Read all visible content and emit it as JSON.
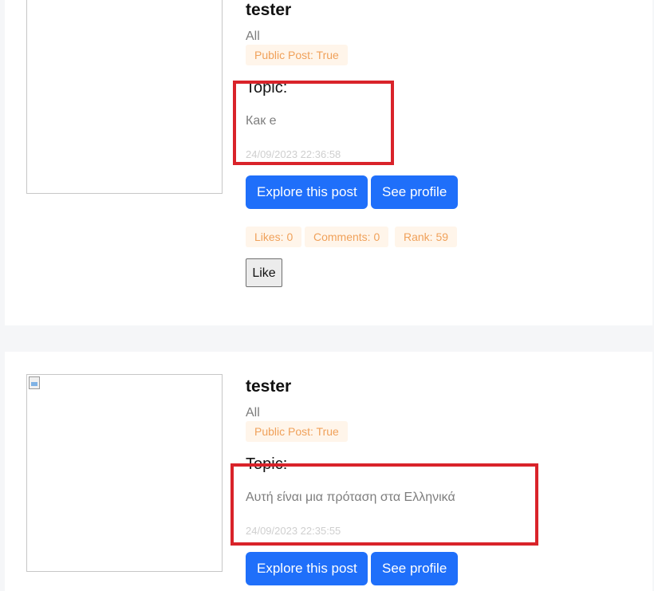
{
  "posts": [
    {
      "username": "tester",
      "audience": "All",
      "public_badge": "Public Post: True",
      "topic_label": "Topic:",
      "topic_text": "Как е",
      "timestamp": "24/09/2023 22:36:58",
      "explore_label": "Explore this post",
      "profile_label": "See profile",
      "likes": "Likes: 0",
      "comments": "Comments: 0",
      "rank": "Rank: 59",
      "like_label": "Like"
    },
    {
      "username": "tester",
      "audience": "All",
      "public_badge": "Public Post: True",
      "topic_label": "Topic:",
      "topic_text": "Αυτή είναι μια πρόταση στα Ελληνικά",
      "timestamp": "24/09/2023 22:35:55",
      "explore_label": "Explore this post",
      "profile_label": "See profile"
    }
  ],
  "colors": {
    "highlight": "#d9232a",
    "button_primary": "#1f6ffa",
    "badge_text": "#f0a15a",
    "badge_bg": "#fff5ea"
  }
}
